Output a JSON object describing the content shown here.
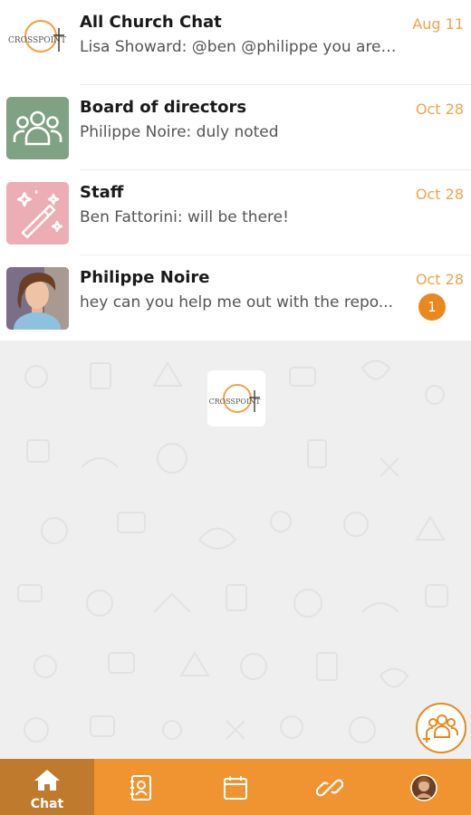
{
  "colors": {
    "accent": "#ef9430",
    "accent_dark": "#c07a2e",
    "badge": "#e8881f",
    "date": "#f0a44c",
    "board_avatar": "#7fa184",
    "staff_avatar": "#ecaeb4"
  },
  "chats": [
    {
      "name": "All Church Chat",
      "preview": "Lisa Showard: @ben @philippe you are ...",
      "date": "Aug 11",
      "avatar_icon": "crosspoint-logo-icon"
    },
    {
      "name": "Board of directors",
      "preview": "Philippe Noire: duly noted",
      "date": "Oct 28",
      "avatar_icon": "group-icon"
    },
    {
      "name": "Staff",
      "preview": "Ben Fattorini: will be there!",
      "date": "Oct 28",
      "avatar_icon": "magic-wand-icon"
    },
    {
      "name": "Philippe Noire",
      "preview": "hey can you help me out with the repo...",
      "date": "Oct 28",
      "unread": "1",
      "avatar_icon": "user-photo"
    }
  ],
  "logo": {
    "text": "CROSSPOINT"
  },
  "nav": {
    "chat_label": "Chat",
    "tabs": [
      "home-icon",
      "contacts-icon",
      "calendar-icon",
      "link-icon",
      "profile-avatar"
    ]
  }
}
